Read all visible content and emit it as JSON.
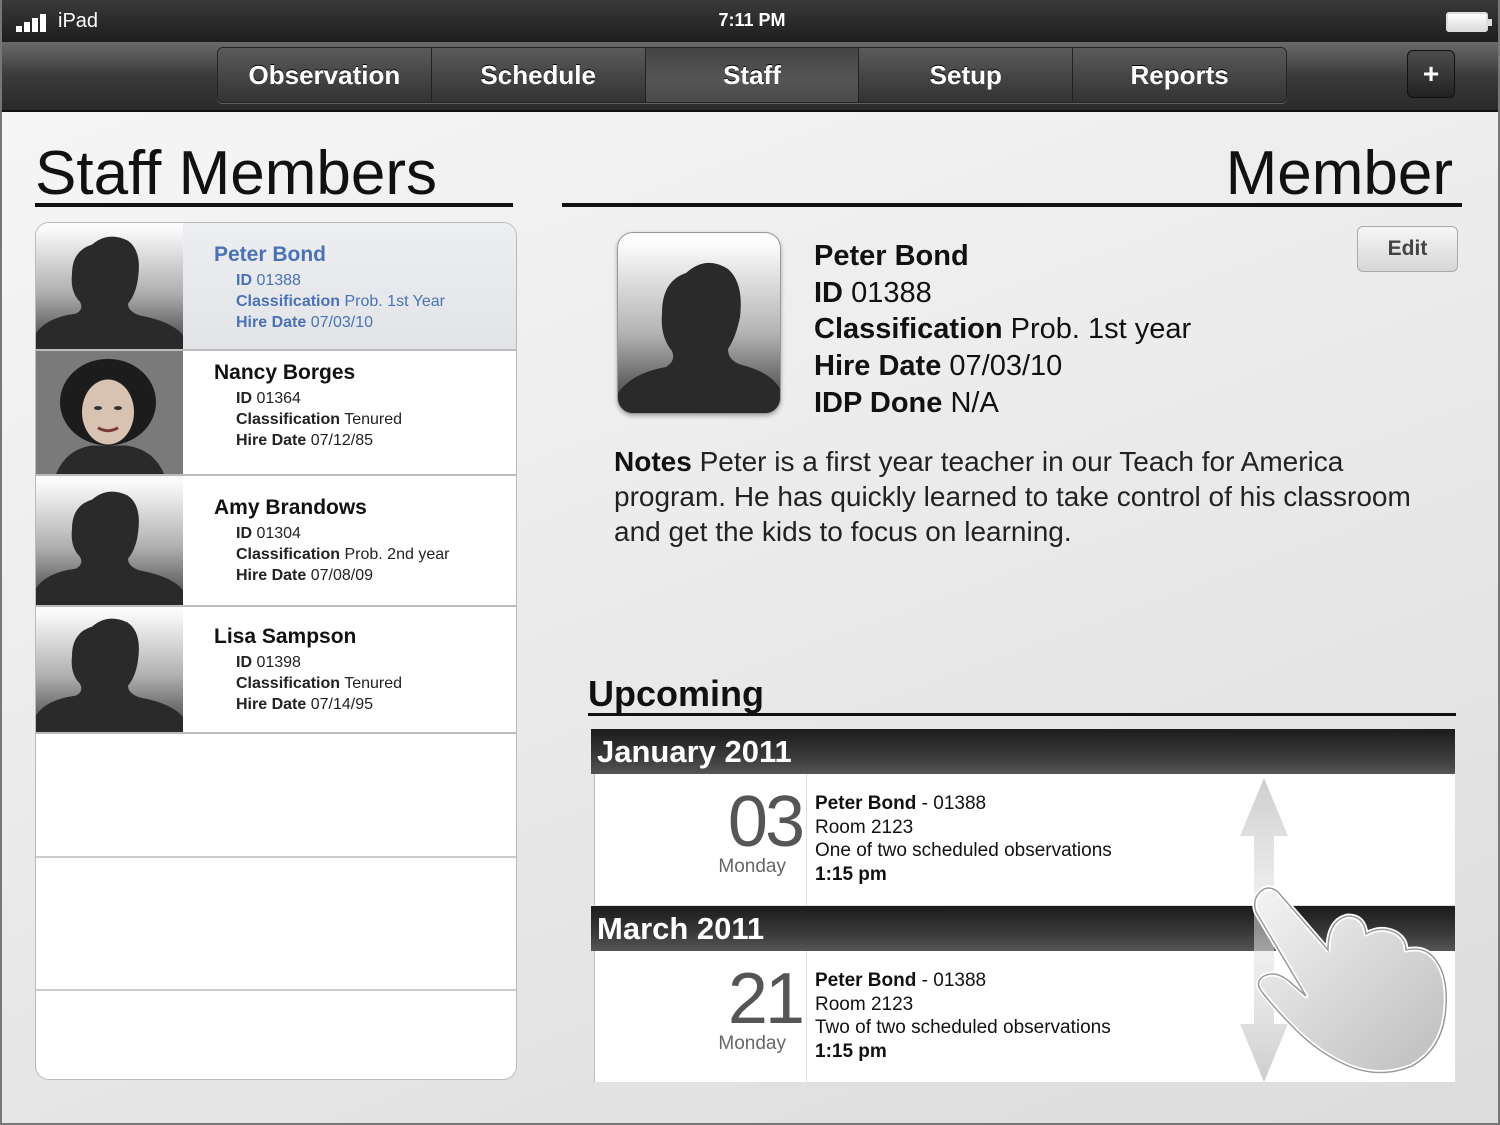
{
  "status_bar": {
    "device": "iPad",
    "time": "7:11 PM"
  },
  "nav": {
    "tabs": [
      {
        "label": "Observation"
      },
      {
        "label": "Schedule"
      },
      {
        "label": "Staff"
      },
      {
        "label": "Setup"
      },
      {
        "label": "Reports"
      }
    ],
    "active_tab": "Staff",
    "add_label": "+"
  },
  "staff_panel": {
    "title": "Staff Members",
    "members": [
      {
        "name": "Peter Bond",
        "id_label": "ID",
        "id": "01388",
        "class_label": "Classification",
        "classification": "Prob. 1st Year",
        "hire_label": "Hire Date",
        "hire_date": "07/03/10",
        "photo": "silhouette"
      },
      {
        "name": "Nancy Borges",
        "id_label": "ID",
        "id": "01364",
        "class_label": "Classification",
        "classification": "Tenured",
        "hire_label": "Hire Date",
        "hire_date": "07/12/85",
        "photo": "portrait"
      },
      {
        "name": "Amy Brandows",
        "id_label": "ID",
        "id": "01304",
        "class_label": "Classification",
        "classification": "Prob. 2nd year",
        "hire_label": "Hire Date",
        "hire_date": "07/08/09",
        "photo": "silhouette"
      },
      {
        "name": "Lisa Sampson",
        "id_label": "ID",
        "id": "01398",
        "class_label": "Classification",
        "classification": "Tenured",
        "hire_label": "Hire Date",
        "hire_date": "07/14/95",
        "photo": "silhouette"
      }
    ]
  },
  "member_panel": {
    "title": "Member",
    "edit_label": "Edit",
    "name": "Peter Bond",
    "id_label": "ID",
    "id": "01388",
    "class_label": "Classification",
    "classification": "Prob. 1st year",
    "hire_label": "Hire Date",
    "hire_date": "07/03/10",
    "idp_label": "IDP Done",
    "idp": "N/A",
    "notes_label": "Notes",
    "notes": "Peter is a first year teacher in our Teach for America program. He has quickly learned to take control of his classroom and get the kids to focus on learning."
  },
  "upcoming": {
    "title": "Upcoming",
    "months": [
      {
        "month": "January 2011",
        "event": {
          "day": "03",
          "weekday": "Monday",
          "name": "Peter Bond",
          "separator": " - ",
          "id": "01388",
          "room": "Room 2123",
          "description": "One of two scheduled observations",
          "time": "1:15 pm"
        }
      },
      {
        "month": "March 2011",
        "event": {
          "day": "21",
          "weekday": "Monday",
          "name": "Peter Bond",
          "separator": " - ",
          "id": "01388",
          "room": "Room 2123",
          "description": "Two of two scheduled observations",
          "time": "1:15 pm"
        }
      }
    ]
  },
  "icons": {
    "signal": "signal-bars-icon",
    "battery": "battery-icon",
    "scroll": "scroll-arrow-icon",
    "gesture": "swipe-hand-icon"
  }
}
